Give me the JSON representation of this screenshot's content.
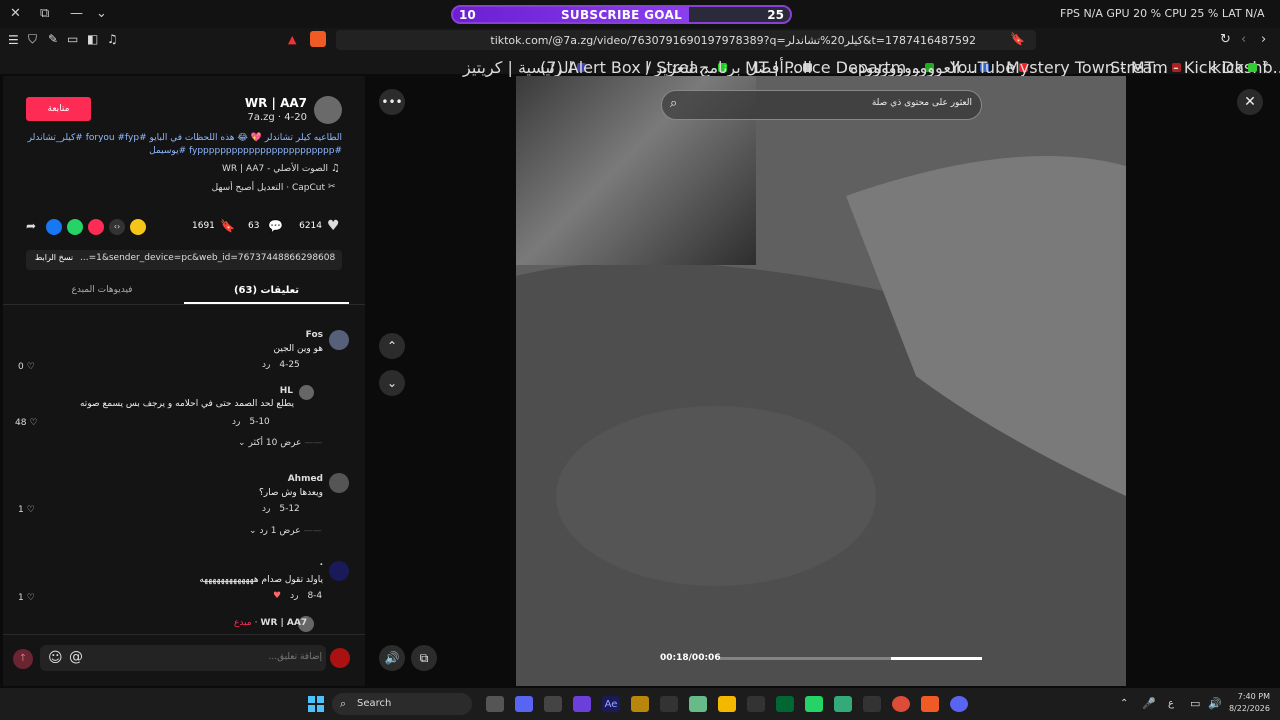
{
  "titlebar": {
    "goal_left": "10",
    "goal_label": "SUBSCRIBE GOAL",
    "goal_right": "25",
    "perf": "FPS N/A GPU 20 % CPU 25 % LAT N/A"
  },
  "browser": {
    "url": "tiktok.com/@7a.zg/video/7630791690197978389?q=كيلر20%تشاندلر&t=1787416487592"
  },
  "bookmarks": [
    "الرئيسية | كريتيز",
    "(7) Alert Box / Strea...",
    "أفضل برنامج لتعزيز ا...",
    "MT | Police Departm...",
    "العووووووووووده...",
    "YouTube",
    "Mystery Town - MT...",
    "Stream - Kick Dashb...",
    "kick"
  ],
  "video_post": {
    "author": "WR | AA7",
    "handle_date": "4-20 · 7a.zg",
    "follow_label": "متابعة",
    "caption_1": "الطاعيه كيلر تشاندلر 💖 😂 هذه اللحظات في البايو #foryou #fyp #كيلر_تشاندلر",
    "caption_2": "#fypppppppppppppppppppppppp #يوسيمل",
    "sound": "الصوت الأصلي - WR | AA7",
    "capcut": "CapCut · التعديل أصبح أسهل",
    "likes": "6214",
    "comments": "63",
    "saves": "1691",
    "link": "...=1&sender_device=pc&web_id=7673744886629860885",
    "copy_link": "نسخ الرابط",
    "tab_comments": "تعليقات (63)",
    "tab_creator_videos": "فيديوهات المبدع"
  },
  "comments": [
    {
      "name": "Fos",
      "text": "هو وين الجين",
      "date": "4-25",
      "reply": "رد",
      "likes": "0"
    },
    {
      "name": "HL",
      "text": "يطلع لحد الصمد حتى في احلامه و يرجف بس يسمع صوته",
      "date": "5-10",
      "reply": "رد",
      "likes": "48",
      "more": "عرض 10 أكثر"
    },
    {
      "name": "Ahmed",
      "text": "ويعدها وش صار؟",
      "date": "5-12",
      "reply": "رد",
      "likes": "1",
      "more": "عرض 1 رد"
    },
    {
      "name": ".",
      "text": "ياولد تقول صدام هههههههههههههه",
      "date": "8-4",
      "reply": "رد",
      "likes": "1"
    }
  ],
  "creator_reply": {
    "name": "WR | AA7",
    "badge": "مبدع"
  },
  "comment_input_placeholder": "إضافة تعليق...",
  "search": {
    "placeholder": "العثور على محتوى ذي صلة"
  },
  "player": {
    "time": "00:18/00:06"
  },
  "taskbar": {
    "search": "Search",
    "lang": "ع",
    "time": "7:40 PM",
    "date": "8/22/2026"
  }
}
